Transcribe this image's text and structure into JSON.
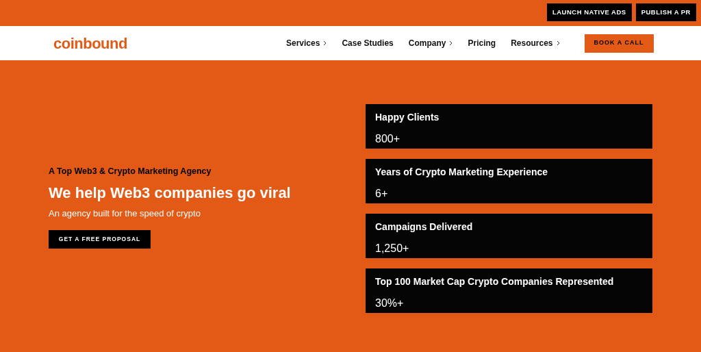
{
  "top_bar": {
    "buttons": [
      "LAUNCH NATIVE ADS",
      "PUBLISH A PR"
    ]
  },
  "nav": {
    "logo": "coinbound",
    "items": [
      {
        "label": "Services",
        "has_submenu": true
      },
      {
        "label": "Case Studies",
        "has_submenu": false
      },
      {
        "label": "Company",
        "has_submenu": true
      },
      {
        "label": "Pricing",
        "has_submenu": false
      },
      {
        "label": "Resources",
        "has_submenu": true
      }
    ],
    "cta": "BOOK A CALL"
  },
  "hero": {
    "eyebrow": "A Top Web3 & Crypto Marketing Agency",
    "headline": "We help Web3 companies go viral",
    "subheadline": "An agency built for the speed of crypto",
    "button": "GET A FREE PROPOSAL"
  },
  "stats": [
    {
      "label": "Happy Clients",
      "value": "800+"
    },
    {
      "label": "Years of Crypto Marketing Experience",
      "value": "6+"
    },
    {
      "label": "Campaigns Delivered",
      "value": "1,250+"
    },
    {
      "label": "Top 100 Market Cap Crypto Companies Represented",
      "value": "30%+"
    }
  ]
}
